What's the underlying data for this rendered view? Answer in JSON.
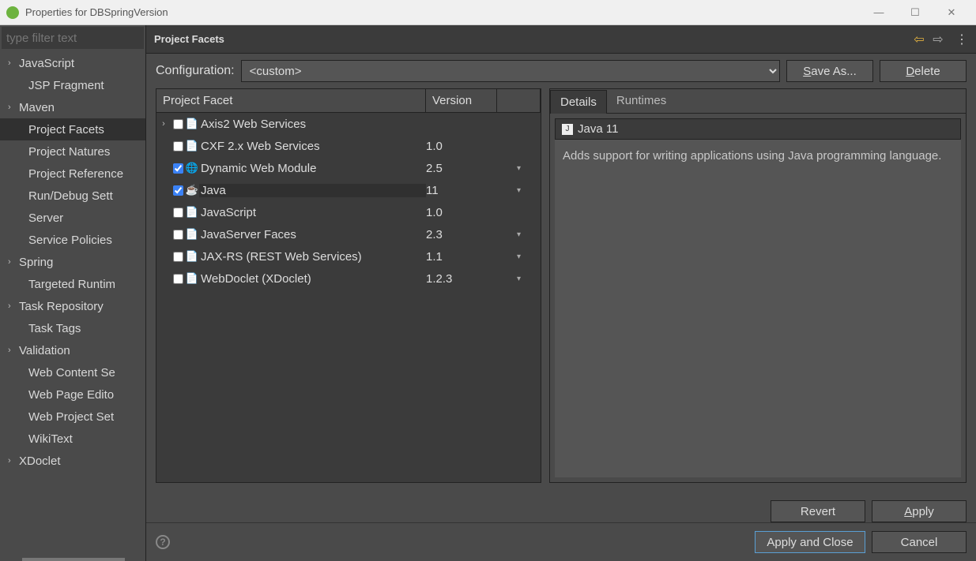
{
  "window": {
    "title": "Properties for DBSpringVersion"
  },
  "sidebar": {
    "filter_placeholder": "type filter text",
    "items": [
      {
        "label": "JavaScript",
        "has_children": true,
        "child": false,
        "selected": false
      },
      {
        "label": "JSP Fragment",
        "has_children": false,
        "child": true,
        "selected": false
      },
      {
        "label": "Maven",
        "has_children": true,
        "child": false,
        "selected": false
      },
      {
        "label": "Project Facets",
        "has_children": false,
        "child": true,
        "selected": true
      },
      {
        "label": "Project Natures",
        "has_children": false,
        "child": true,
        "selected": false
      },
      {
        "label": "Project Reference",
        "has_children": false,
        "child": true,
        "selected": false
      },
      {
        "label": "Run/Debug Sett",
        "has_children": false,
        "child": true,
        "selected": false
      },
      {
        "label": "Server",
        "has_children": false,
        "child": true,
        "selected": false
      },
      {
        "label": "Service Policies",
        "has_children": false,
        "child": true,
        "selected": false
      },
      {
        "label": "Spring",
        "has_children": true,
        "child": false,
        "selected": false
      },
      {
        "label": "Targeted Runtim",
        "has_children": false,
        "child": true,
        "selected": false
      },
      {
        "label": "Task Repository",
        "has_children": true,
        "child": false,
        "selected": false
      },
      {
        "label": "Task Tags",
        "has_children": false,
        "child": true,
        "selected": false
      },
      {
        "label": "Validation",
        "has_children": true,
        "child": false,
        "selected": false
      },
      {
        "label": "Web Content Se",
        "has_children": false,
        "child": true,
        "selected": false
      },
      {
        "label": "Web Page Edito",
        "has_children": false,
        "child": true,
        "selected": false
      },
      {
        "label": "Web Project Set",
        "has_children": false,
        "child": true,
        "selected": false
      },
      {
        "label": "WikiText",
        "has_children": false,
        "child": true,
        "selected": false
      },
      {
        "label": "XDoclet",
        "has_children": true,
        "child": false,
        "selected": false
      }
    ]
  },
  "header": {
    "title": "Project Facets"
  },
  "config": {
    "label": "Configuration:",
    "value": "<custom>",
    "save_as": "Save As...",
    "delete": "Delete"
  },
  "table": {
    "col_facet": "Project Facet",
    "col_version": "Version",
    "rows": [
      {
        "name": "Axis2 Web Services",
        "version": "",
        "checked": false,
        "expandable": true,
        "icon": "📄",
        "dd": false,
        "selected": false
      },
      {
        "name": "CXF 2.x Web Services",
        "version": "1.0",
        "checked": false,
        "expandable": false,
        "icon": "📄",
        "dd": false,
        "selected": false
      },
      {
        "name": "Dynamic Web Module",
        "version": "2.5",
        "checked": true,
        "expandable": false,
        "icon": "🌐",
        "dd": true,
        "selected": false
      },
      {
        "name": "Java",
        "version": "11",
        "checked": true,
        "expandable": false,
        "icon": "☕",
        "dd": true,
        "selected": true
      },
      {
        "name": "JavaScript",
        "version": "1.0",
        "checked": false,
        "expandable": false,
        "icon": "📄",
        "dd": false,
        "selected": false
      },
      {
        "name": "JavaServer Faces",
        "version": "2.3",
        "checked": false,
        "expandable": false,
        "icon": "📄",
        "dd": true,
        "selected": false
      },
      {
        "name": "JAX-RS (REST Web Services)",
        "version": "1.1",
        "checked": false,
        "expandable": false,
        "icon": "📄",
        "dd": true,
        "selected": false
      },
      {
        "name": "WebDoclet (XDoclet)",
        "version": "1.2.3",
        "checked": false,
        "expandable": false,
        "icon": "📄",
        "dd": true,
        "selected": false
      }
    ]
  },
  "details": {
    "tab_details": "Details",
    "tab_runtimes": "Runtimes",
    "panel_title": "Java 11",
    "panel_desc": "Adds support for writing applications using Java programming language."
  },
  "buttons": {
    "revert": "Revert",
    "apply": "Apply",
    "apply_close": "Apply and Close",
    "cancel": "Cancel"
  }
}
